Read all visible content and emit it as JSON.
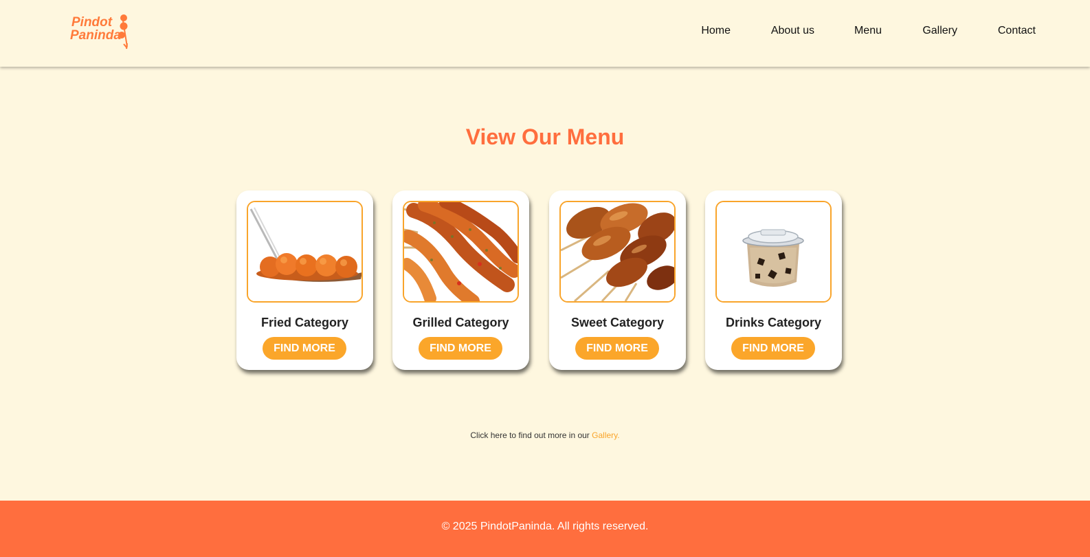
{
  "brand": {
    "logo_line1": "Pindot",
    "logo_line2": "Paninda",
    "accent": "#ff6e3e",
    "button": "#fba62a",
    "background": "#fef7df"
  },
  "nav": {
    "items": [
      "Home",
      "About us",
      "Menu",
      "Gallery",
      "Contact"
    ]
  },
  "menu_section": {
    "title": "View Our Menu",
    "cards": [
      {
        "title": "Fried Category",
        "button": "FIND MORE",
        "image_icon": "fried-fishballs-image"
      },
      {
        "title": "Grilled Category",
        "button": "FIND MORE",
        "image_icon": "grilled-skewers-image"
      },
      {
        "title": "Sweet Category",
        "button": "FIND MORE",
        "image_icon": "banana-cue-image"
      },
      {
        "title": "Drinks Category",
        "button": "FIND MORE",
        "image_icon": "gulaman-drink-cup-image"
      }
    ]
  },
  "info": {
    "text": "Click here to find out more in our ",
    "link": "Gallery."
  },
  "footer": {
    "text": "© 2025 PindotPaninda. All rights reserved."
  }
}
